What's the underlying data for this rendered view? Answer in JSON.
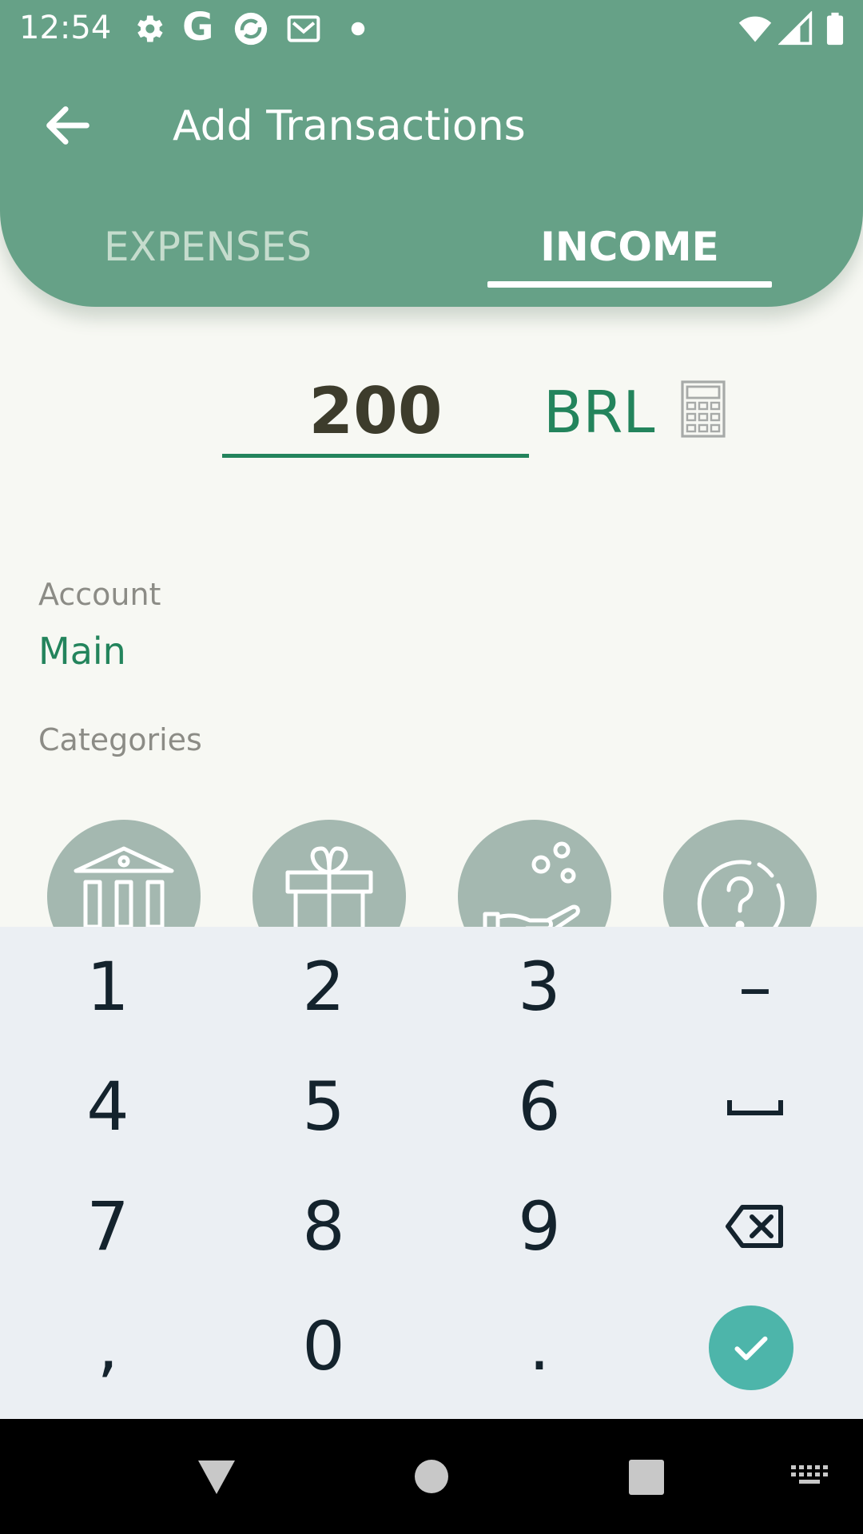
{
  "status_bar": {
    "time": "12:54",
    "app_icons": [
      "settings-icon",
      "google-icon",
      "sync-icon",
      "mail-icon",
      "dot-icon"
    ],
    "system_icons": [
      "wifi-icon",
      "signal-icon",
      "battery-icon"
    ]
  },
  "header": {
    "title": "Add Transactions",
    "back_icon": "arrow-left-icon",
    "tabs": [
      {
        "label": "EXPENSES",
        "selected": false
      },
      {
        "label": "INCOME",
        "selected": true
      }
    ]
  },
  "amount": {
    "value": "200",
    "currency": "BRL",
    "calculator_icon": "calculator-icon"
  },
  "account": {
    "label": "Account",
    "value": "Main"
  },
  "categories": {
    "label": "Categories",
    "items": [
      {
        "icon": "bank-icon"
      },
      {
        "icon": "gift-icon"
      },
      {
        "icon": "coins-hand-icon"
      },
      {
        "icon": "question-icon"
      }
    ]
  },
  "keypad": {
    "rows": [
      [
        "1",
        "2",
        "3",
        "–"
      ],
      [
        "4",
        "5",
        "6",
        "␣"
      ],
      [
        "7",
        "8",
        "9",
        "⌫"
      ],
      [
        ",",
        "0",
        ".",
        "✓"
      ]
    ]
  },
  "colors": {
    "header": "#66a187",
    "accent": "#23845c",
    "keyboard_bg": "#ebeff3",
    "done_button": "#4db5aa"
  }
}
